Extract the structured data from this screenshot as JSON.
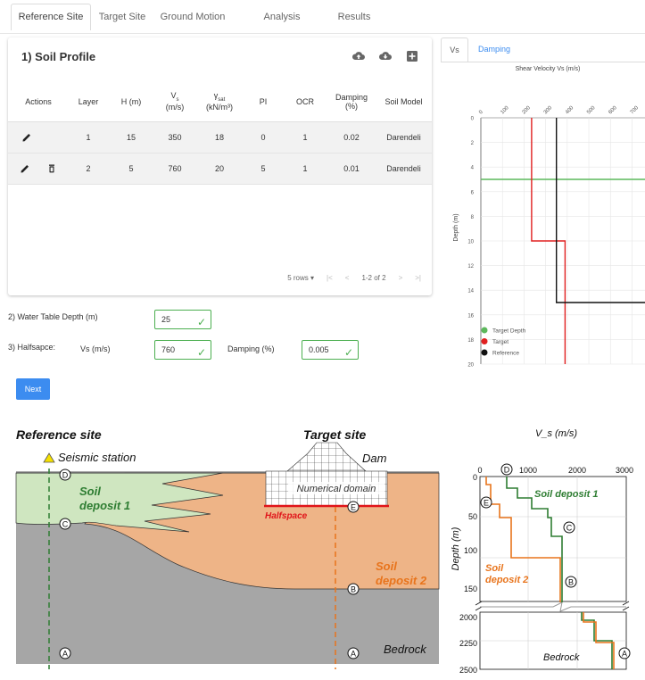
{
  "tabs": [
    "Reference Site",
    "Target Site",
    "Ground Motion",
    "Analysis Parameters",
    "Results"
  ],
  "card": {
    "title": "1) Soil Profile"
  },
  "table": {
    "headers": {
      "actions": "Actions",
      "layer": "Layer",
      "h": "H (m)",
      "vs_main": "V",
      "vs_sub": "s",
      "vs_unit": "(m/s)",
      "gamma_main": "γ",
      "gamma_sub": "sat",
      "gamma_unit": "(kN/m³)",
      "pi": "PI",
      "ocr": "OCR",
      "damping": "Damping",
      "damping_unit": "(%)",
      "model": "Soil Model"
    },
    "rows": [
      {
        "layer": "1",
        "h": "15",
        "vs": "350",
        "gamma": "18",
        "pi": "0",
        "ocr": "1",
        "damping": "0.02",
        "model": "Darendeli"
      },
      {
        "layer": "2",
        "h": "5",
        "vs": "760",
        "gamma": "20",
        "pi": "5",
        "ocr": "1",
        "damping": "0.01",
        "model": "Darendeli"
      }
    ]
  },
  "pager": {
    "rows_label": "5 rows",
    "range": "1-2 of 2"
  },
  "water_table": {
    "label": "2) Water Table Depth (m)",
    "value": "25"
  },
  "halfspace": {
    "label": "3) Halfsapce:",
    "vs_label": "Vs (m/s)",
    "vs_value": "760",
    "damping_label": "Damping (%)",
    "damping_value": "0.005"
  },
  "next_label": "Next",
  "plot_tabs": [
    "Vs",
    "Damping"
  ],
  "vs_plot": {
    "title": "Shear Velocity Vs (m/s)",
    "ylabel": "Depth (m)",
    "x_ticks": [
      "0",
      "100",
      "200",
      "300",
      "400",
      "500",
      "600",
      "700"
    ],
    "y_ticks": [
      "0",
      "2",
      "4",
      "6",
      "8",
      "10",
      "12",
      "14",
      "16",
      "18",
      "20"
    ],
    "legend": [
      "Target Depth",
      "Target",
      "Reference"
    ],
    "colors": {
      "target_depth": "#5cb85c",
      "target": "#e02020",
      "reference": "#111111"
    }
  },
  "chart_data": {
    "type": "line",
    "title": "Shear Velocity Vs (m/s)",
    "xlabel": "",
    "ylabel": "Depth (m)",
    "xlim": [
      0,
      760
    ],
    "ylim": [
      0,
      20
    ],
    "series": [
      {
        "name": "Target Depth",
        "x": [
          0,
          760
        ],
        "y": [
          5,
          5
        ]
      },
      {
        "name": "Target",
        "x": [
          235,
          235,
          390,
          390
        ],
        "y": [
          0,
          10,
          10,
          20
        ]
      },
      {
        "name": "Reference",
        "x": [
          350,
          350,
          760
        ],
        "y": [
          0,
          15,
          15
        ]
      }
    ]
  },
  "figure": {
    "reference_site": "Reference site",
    "target_site": "Target site",
    "seismic_station": "Seismic station",
    "dam": "Dam",
    "numerical_domain": "Numerical domain",
    "halfspace": "Halfspace",
    "soil_deposit_1": [
      "Soil",
      "deposit 1"
    ],
    "soil_deposit_2": [
      "Soil",
      "deposit 2"
    ],
    "bedrock": "Bedrock",
    "points": [
      "A",
      "B",
      "C",
      "D",
      "E"
    ],
    "colors": {
      "deposit1": "#cfe6c0",
      "deposit2": "#eeb487",
      "bedrock": "#a6a6a6",
      "halfspace": "#e0141a",
      "reference_line": "#2e7d32",
      "target_line": "#e8741c"
    }
  },
  "profile_plot": {
    "xlabel": "V_s (m/s)",
    "ylabel": "Depth (m)",
    "x_ticks": [
      "0",
      "1000",
      "2000",
      "3000"
    ],
    "y_ticks_top": [
      "0",
      "50",
      "100",
      "150"
    ],
    "y_ticks_bottom": [
      "2000",
      "2250",
      "2500"
    ],
    "label_deposit1": "Soil deposit 1",
    "label_deposit2": [
      "Soil",
      "deposit 2"
    ],
    "label_bedrock": "Bedrock"
  }
}
